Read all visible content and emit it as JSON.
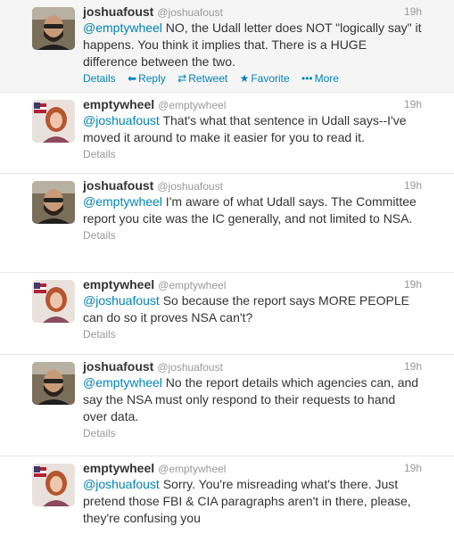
{
  "tweets": [
    {
      "fullname": "joshuafoust",
      "username": "@joshuafoust",
      "time": "19h",
      "mention": "@emptywheel",
      "text": " NO, the Udall letter does NOT \"logically say\" it happens. You think it implies that. There is a HUGE difference between the two.",
      "avatar": "man-avatar",
      "actions": {
        "details": "Details",
        "reply": "Reply",
        "retweet": "Retweet",
        "favorite": "Favorite",
        "more": "More"
      }
    },
    {
      "fullname": "emptywheel",
      "username": "@emptywheel",
      "time": "19h",
      "mention": "@joshuafoust",
      "text": " That's what that sentence in Udall says--I've moved it around to make it easier for you to read it.",
      "avatar": "woman-flag-avatar",
      "actions": {
        "details": "Details"
      }
    },
    {
      "fullname": "joshuafoust",
      "username": "@joshuafoust",
      "time": "19h",
      "mention": "@emptywheel",
      "text": " I'm aware of what Udall says. The Committee report you cite was the IC generally, and not limited to NSA.",
      "avatar": "man-avatar",
      "actions": {
        "details": "Details"
      }
    },
    {
      "fullname": "emptywheel",
      "username": "@emptywheel",
      "time": "19h",
      "mention": "@joshuafoust",
      "text": " So because the report says MORE PEOPLE can do so it proves NSA can't?",
      "avatar": "woman-flag-avatar",
      "actions": {
        "details": "Details"
      }
    },
    {
      "fullname": "joshuafoust",
      "username": "@joshuafoust",
      "time": "19h",
      "mention": "@emptywheel",
      "text": " No the report details which agencies can, and say the NSA must only respond to their requests to hand over data.",
      "avatar": "man-avatar",
      "actions": {
        "details": "Details"
      }
    },
    {
      "fullname": "emptywheel",
      "username": "@emptywheel",
      "time": "19h",
      "mention": "@joshuafoust",
      "text": " Sorry. You're misreading what's there. Just pretend those FBI & CIA paragraphs aren't in there, please, they're confusing you",
      "avatar": "woman-flag-avatar",
      "actions": {}
    }
  ],
  "colors": {
    "link": "#0084b4",
    "muted": "#999999",
    "text": "#333333",
    "highlight_bg": "#f5f5f5"
  }
}
